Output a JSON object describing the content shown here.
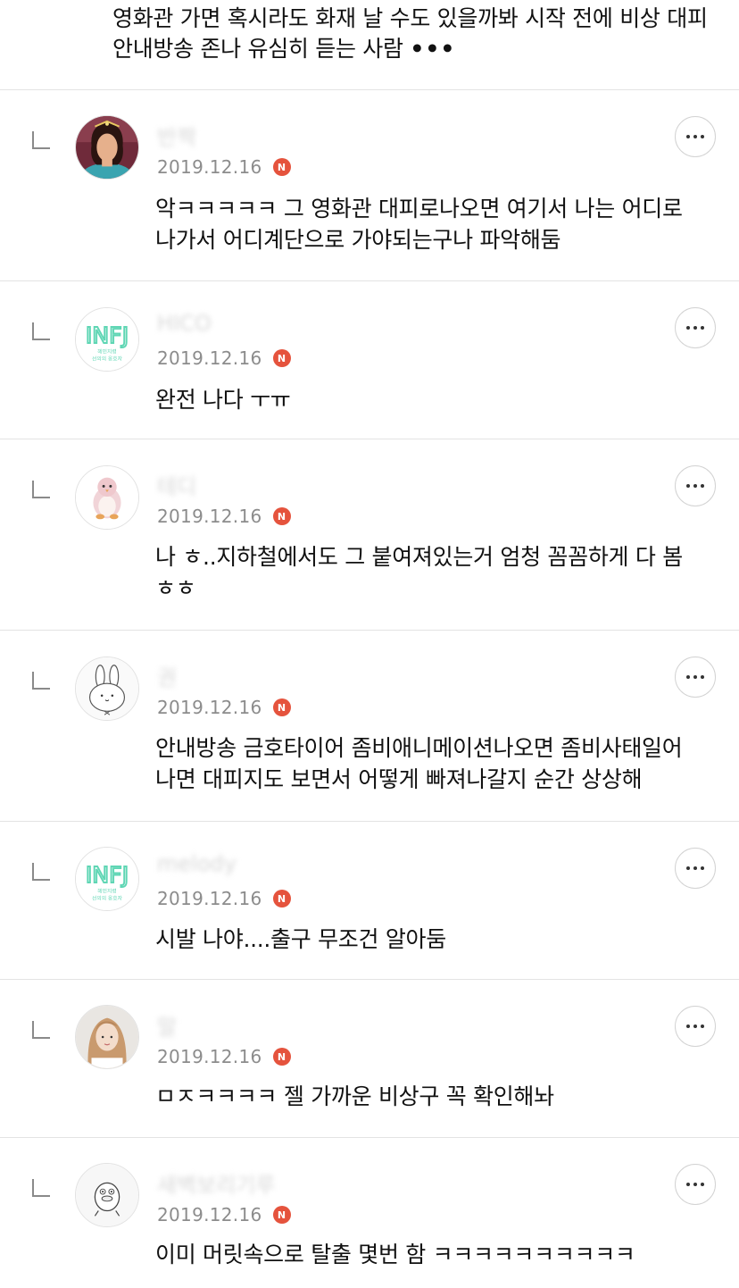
{
  "top_comment": {
    "text": "영화관 가면 혹시라도 화재 날 수도 있을까봐 시작 전에 비상 대피안내방송 존나 유심히 듣는 사람",
    "more": "•••"
  },
  "comments": [
    {
      "nickname": "반짝",
      "date": "2019.12.16",
      "badge": "N",
      "avatar": "woman-portrait-avatar",
      "text": "악ㅋㅋㅋㅋㅋ 그 영화관 대피로나오면 여기서 나는 어디로 나가서 어디계단으로 가야되는구나 파악해둠"
    },
    {
      "nickname": "HICO",
      "date": "2019.12.16",
      "badge": "N",
      "avatar": "infj-avatar",
      "avatar_text": "INFJ",
      "avatar_sub1": "헤민지령",
      "avatar_sub2": "선의의 옹호자",
      "text": "완전 나다 ㅜㅠ"
    },
    {
      "nickname": "테디",
      "date": "2019.12.16",
      "badge": "N",
      "avatar": "penguin-plush-avatar",
      "text": "나 ㅎ..지하철에서도 그 붙여져있는거 엄청 꼼꼼하게 다 봄 ㅎㅎ"
    },
    {
      "nickname": "권",
      "date": "2019.12.16",
      "badge": "N",
      "avatar": "bunny-doodle-avatar",
      "text": "안내방송 금호타이어 좀비애니메이션나오면 좀비사태일어나면 대피지도 보면서 어떻게 빠져나갈지 순간 상상해"
    },
    {
      "nickname": "melody",
      "date": "2019.12.16",
      "badge": "N",
      "avatar": "infj-avatar",
      "avatar_text": "INFJ",
      "avatar_sub1": "헤민지령",
      "avatar_sub2": "선의의 옹호자",
      "text": "시발 나야....출구 무조건 알아둠"
    },
    {
      "nickname": "말",
      "date": "2019.12.16",
      "badge": "N",
      "avatar": "girl-portrait-avatar",
      "text": "ㅁㅈㅋㅋㅋㅋ 젤 가까운 비상구 꼭 확인해놔"
    },
    {
      "nickname": "새벽보리기루",
      "date": "2019.12.16",
      "badge": "N",
      "avatar": "duck-doodle-avatar",
      "text": "이미 머릿속으로 탈출 몇번 함 ㅋㅋㅋㅋㅋㅋㅋㅋㅋㅋ"
    }
  ],
  "colors": {
    "badge": "#e5533d",
    "divider": "#e3e3e3",
    "date": "#8c8c8c",
    "infj": "#5fd6b4"
  }
}
